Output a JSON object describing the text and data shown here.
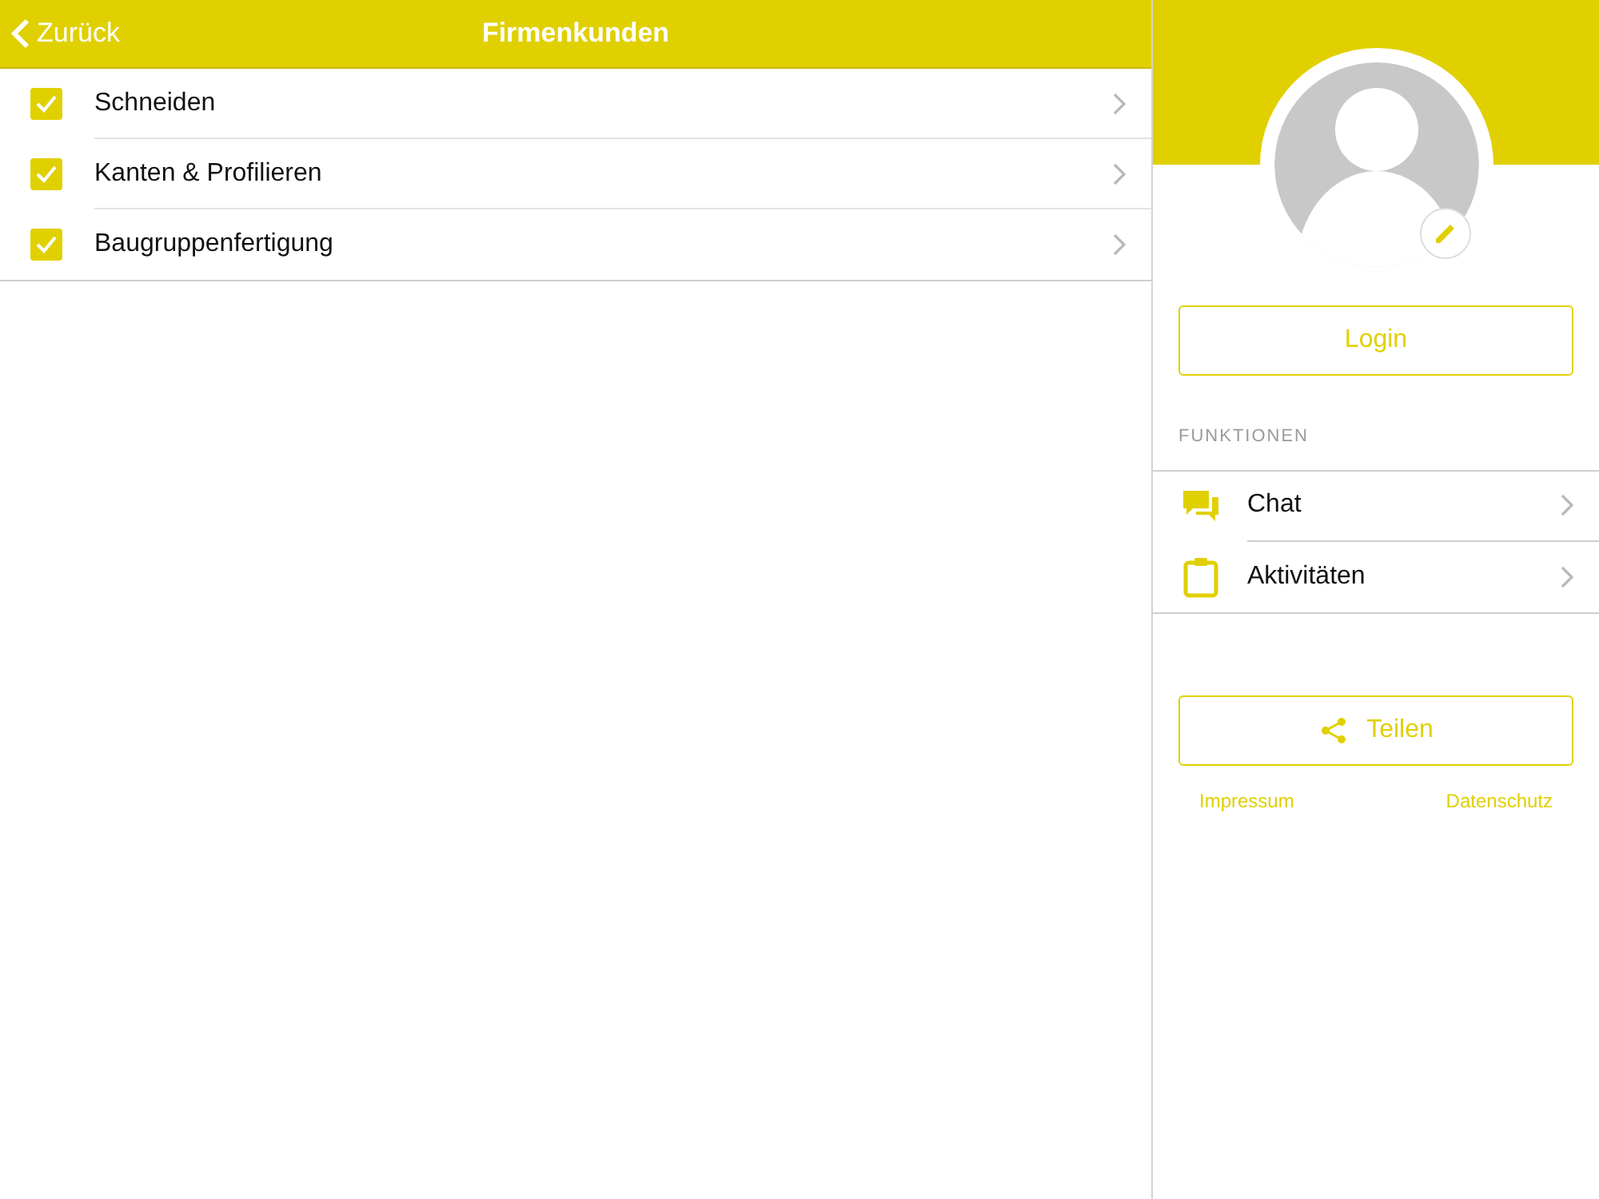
{
  "nav": {
    "back": "Zurück",
    "title": "Firmenkunden"
  },
  "categories": [
    {
      "label": "Schneiden",
      "checked": true
    },
    {
      "label": "Kanten & Profilieren",
      "checked": true
    },
    {
      "label": "Baugruppenfertigung",
      "checked": true
    }
  ],
  "profile": {
    "login": "Login"
  },
  "functions": {
    "heading": "FUNKTIONEN",
    "items": [
      {
        "kind": "chat",
        "label": "Chat"
      },
      {
        "kind": "clipboard",
        "label": "Aktivitäten"
      }
    ]
  },
  "share": "Teilen",
  "links": [
    "Impressum",
    "Datenschutz"
  ]
}
